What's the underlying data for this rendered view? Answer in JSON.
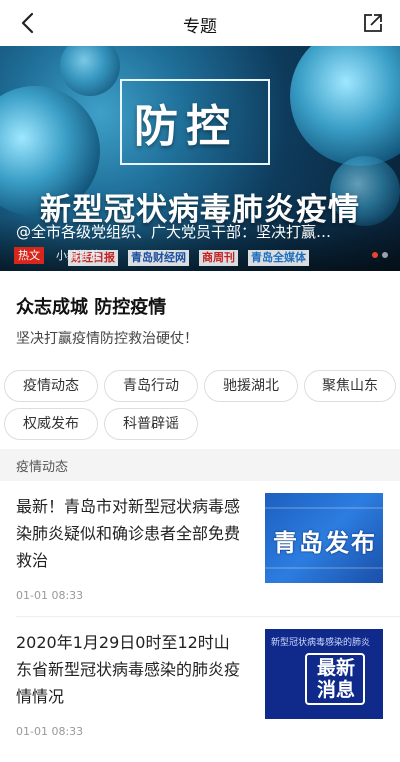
{
  "header": {
    "title": "专题"
  },
  "banner": {
    "big_word": "防控",
    "subtitle": "新型冠状病毒肺炎疫情",
    "media_logos": [
      "财经日报",
      "青岛财经网",
      "商周刊",
      "青岛全媒体"
    ],
    "caption": "@全市各级党组织、广大党员干部：坚决打赢…",
    "hot_badge": "热文",
    "editor_pick": "小编推荐",
    "colors": {
      "hot_badge": "#d8261d",
      "active_dot": "#e8452c"
    }
  },
  "intro": {
    "headline": "众志成城  防控疫情",
    "description": "坚决打赢疫情防控救治硬仗！"
  },
  "tags": [
    "疫情动态",
    "青岛行动",
    "驰援湖北",
    "聚焦山东",
    "权威发布",
    "科普辟谣"
  ],
  "section": {
    "title": "疫情动态"
  },
  "news": [
    {
      "title": "最新！青岛市对新型冠状病毒感染肺炎疑似和确诊患者全部免费救治",
      "time": "01-01 08:33",
      "thumb_text": "青岛发布"
    },
    {
      "title": "2020年1月29日0时至12时山东省新型冠状病毒感染的肺炎疫情情况",
      "time": "01-01 08:33",
      "thumb_top": "新型冠状病毒感染的肺炎",
      "thumb_text": "最新消息"
    }
  ]
}
